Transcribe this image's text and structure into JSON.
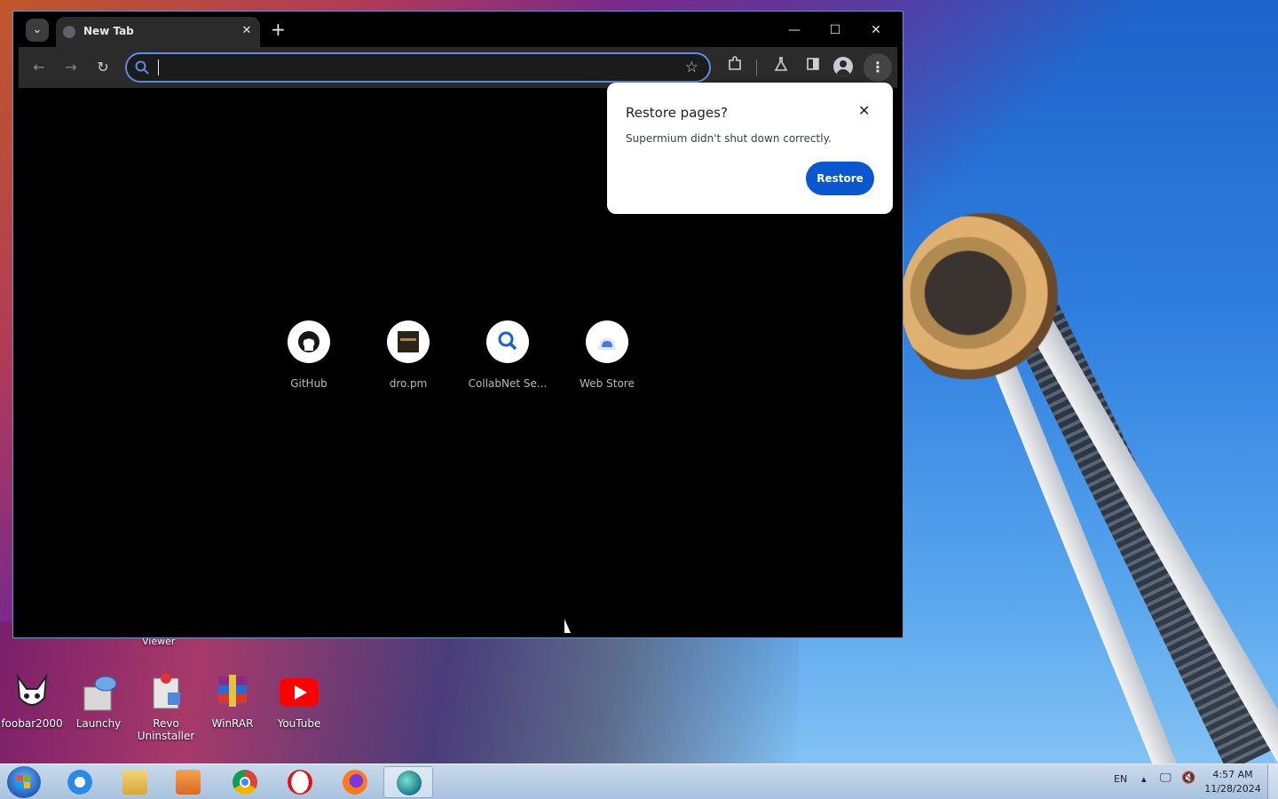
{
  "browser": {
    "tab_title": "New Tab",
    "new_tab_icon": "plus",
    "omnibox_value": "",
    "window_controls": {
      "minimize": "—",
      "maximize": "☐",
      "close": "✕"
    }
  },
  "shortcuts": [
    {
      "label": "GitHub",
      "icon": "github-icon"
    },
    {
      "label": "dro.pm",
      "icon": "dropm-icon"
    },
    {
      "label": "CollabNet Se...",
      "icon": "search-icon"
    },
    {
      "label": "Web Store",
      "icon": "webstore-icon"
    }
  ],
  "restore_dialog": {
    "title": "Restore pages?",
    "message": "Supermium didn't shut down correctly.",
    "button": "Restore"
  },
  "desktop": {
    "viewer_label": "Viewer",
    "icons": [
      {
        "label": "foobar2000"
      },
      {
        "label": "Launchy"
      },
      {
        "label": "Revo Uninstaller"
      },
      {
        "label": "WinRAR"
      },
      {
        "label": "YouTube"
      }
    ]
  },
  "taskbar": {
    "language": "EN",
    "time": "4:57 AM",
    "date": "11/28/2024"
  },
  "colors": {
    "accent": "#0b57d0",
    "omnibox_border": "#5d8ae6"
  }
}
